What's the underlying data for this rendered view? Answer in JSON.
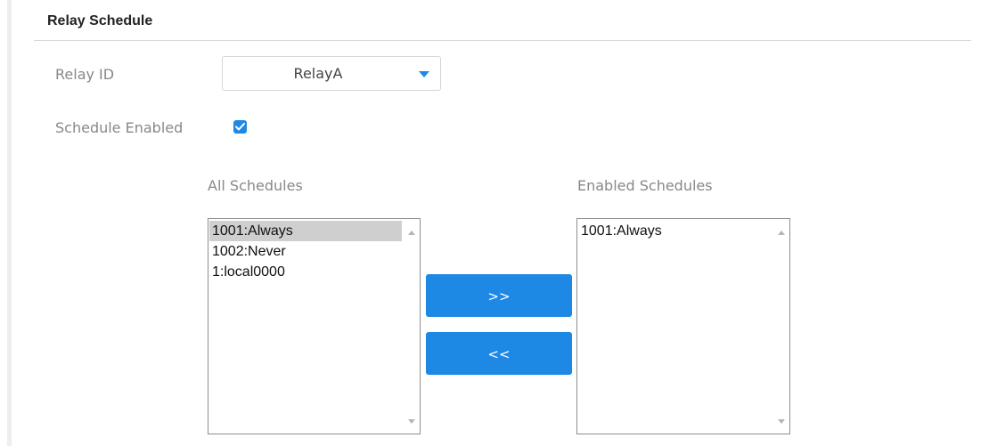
{
  "section": {
    "title": "Relay Schedule"
  },
  "relay_id": {
    "label": "Relay ID",
    "selected": "RelayA",
    "caret_icon": "caret-down-icon"
  },
  "schedule_enabled": {
    "label": "Schedule Enabled",
    "checked": true,
    "icon": "checkmark-icon"
  },
  "all_schedules": {
    "title": "All Schedules",
    "items": [
      "1001:Always",
      "1002:Never",
      "1:local0000"
    ],
    "selected_index": 0
  },
  "enabled_schedules": {
    "title": "Enabled Schedules",
    "items": [
      "1001:Always"
    ]
  },
  "buttons": {
    "add_label": ">>",
    "remove_label": "<<"
  },
  "colors": {
    "accent": "#1e88e5",
    "label_gray": "#888888",
    "selected_item_bg": "#cfcfcf"
  }
}
